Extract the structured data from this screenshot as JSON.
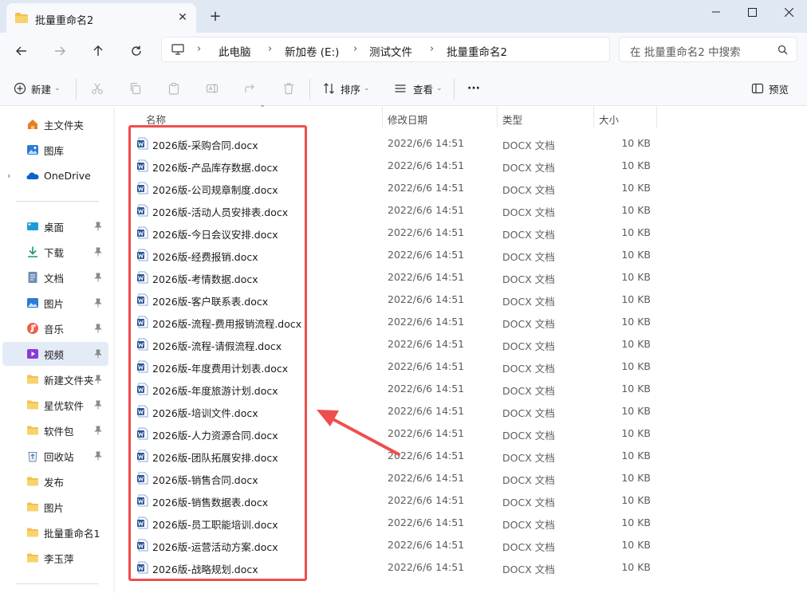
{
  "window": {
    "tab_title": "批量重命名2",
    "tab_close": "✕",
    "new_tab": "+"
  },
  "address": {
    "crumbs": [
      "此电脑",
      "新加卷 (E:)",
      "测试文件",
      "批量重命名2"
    ],
    "separator": "›"
  },
  "search": {
    "placeholder": "在 批量重命名2 中搜索"
  },
  "toolbar": {
    "new_label": "新建",
    "sort_label": "排序",
    "view_label": "查看",
    "more_label": "···",
    "preview_label": "预览"
  },
  "sidebar": {
    "top": [
      {
        "label": "主文件夹",
        "icon": "home-icon"
      },
      {
        "label": "图库",
        "icon": "gallery-icon"
      },
      {
        "label": "OneDrive",
        "icon": "onedrive-icon"
      }
    ],
    "quick": [
      {
        "label": "桌面",
        "icon": "desktop-icon",
        "pinned": true
      },
      {
        "label": "下载",
        "icon": "download-icon",
        "pinned": true
      },
      {
        "label": "文档",
        "icon": "document-icon",
        "pinned": true
      },
      {
        "label": "图片",
        "icon": "pictures-icon",
        "pinned": true
      },
      {
        "label": "音乐",
        "icon": "music-icon",
        "pinned": true
      },
      {
        "label": "视频",
        "icon": "video-icon",
        "pinned": true,
        "active": true
      },
      {
        "label": "新建文件夹",
        "icon": "folder-icon",
        "pinned": true
      },
      {
        "label": "星优软件",
        "icon": "folder-icon",
        "pinned": true
      },
      {
        "label": "软件包",
        "icon": "folder-icon",
        "pinned": true
      },
      {
        "label": "回收站",
        "icon": "recycle-bin-icon",
        "pinned": true
      },
      {
        "label": "发布",
        "icon": "folder-icon",
        "pinned": false
      },
      {
        "label": "图片",
        "icon": "folder-icon",
        "pinned": false
      },
      {
        "label": "批量重命名1",
        "icon": "folder-icon",
        "pinned": false
      },
      {
        "label": "李玉萍",
        "icon": "folder-icon",
        "pinned": false
      }
    ]
  },
  "columns": {
    "name": "名称",
    "date": "修改日期",
    "type": "类型",
    "size": "大小"
  },
  "files": [
    {
      "name": "2026版-采购合同.docx",
      "date": "2022/6/6 14:51",
      "type": "DOCX 文档",
      "size": "10 KB"
    },
    {
      "name": "2026版-产品库存数据.docx",
      "date": "2022/6/6 14:51",
      "type": "DOCX 文档",
      "size": "10 KB"
    },
    {
      "name": "2026版-公司规章制度.docx",
      "date": "2022/6/6 14:51",
      "type": "DOCX 文档",
      "size": "10 KB"
    },
    {
      "name": "2026版-活动人员安排表.docx",
      "date": "2022/6/6 14:51",
      "type": "DOCX 文档",
      "size": "10 KB"
    },
    {
      "name": "2026版-今日会议安排.docx",
      "date": "2022/6/6 14:51",
      "type": "DOCX 文档",
      "size": "10 KB"
    },
    {
      "name": "2026版-经费报销.docx",
      "date": "2022/6/6 14:51",
      "type": "DOCX 文档",
      "size": "10 KB"
    },
    {
      "name": "2026版-考情数据.docx",
      "date": "2022/6/6 14:51",
      "type": "DOCX 文档",
      "size": "10 KB"
    },
    {
      "name": "2026版-客户联系表.docx",
      "date": "2022/6/6 14:51",
      "type": "DOCX 文档",
      "size": "10 KB"
    },
    {
      "name": "2026版-流程-费用报销流程.docx",
      "date": "2022/6/6 14:51",
      "type": "DOCX 文档",
      "size": "10 KB"
    },
    {
      "name": "2026版-流程-请假流程.docx",
      "date": "2022/6/6 14:51",
      "type": "DOCX 文档",
      "size": "10 KB"
    },
    {
      "name": "2026版-年度费用计划表.docx",
      "date": "2022/6/6 14:51",
      "type": "DOCX 文档",
      "size": "10 KB"
    },
    {
      "name": "2026版-年度旅游计划.docx",
      "date": "2022/6/6 14:51",
      "type": "DOCX 文档",
      "size": "10 KB"
    },
    {
      "name": "2026版-培训文件.docx",
      "date": "2022/6/6 14:51",
      "type": "DOCX 文档",
      "size": "10 KB"
    },
    {
      "name": "2026版-人力资源合同.docx",
      "date": "2022/6/6 14:51",
      "type": "DOCX 文档",
      "size": "10 KB"
    },
    {
      "name": "2026版-团队拓展安排.docx",
      "date": "2022/6/6 14:51",
      "type": "DOCX 文档",
      "size": "10 KB"
    },
    {
      "name": "2026版-销售合同.docx",
      "date": "2022/6/6 14:51",
      "type": "DOCX 文档",
      "size": "10 KB"
    },
    {
      "name": "2026版-销售数据表.docx",
      "date": "2022/6/6 14:51",
      "type": "DOCX 文档",
      "size": "10 KB"
    },
    {
      "name": "2026版-员工职能培训.docx",
      "date": "2022/6/6 14:51",
      "type": "DOCX 文档",
      "size": "10 KB"
    },
    {
      "name": "2026版-运营活动方案.docx",
      "date": "2022/6/6 14:51",
      "type": "DOCX 文档",
      "size": "10 KB"
    },
    {
      "name": "2026版-战略规划.docx",
      "date": "2022/6/6 14:51",
      "type": "DOCX 文档",
      "size": "10 KB"
    }
  ],
  "colors": {
    "accent": "#2b7cd3",
    "annotation": "#ef4e4e",
    "folder": "#f2c14e",
    "word": "#2b5797"
  }
}
